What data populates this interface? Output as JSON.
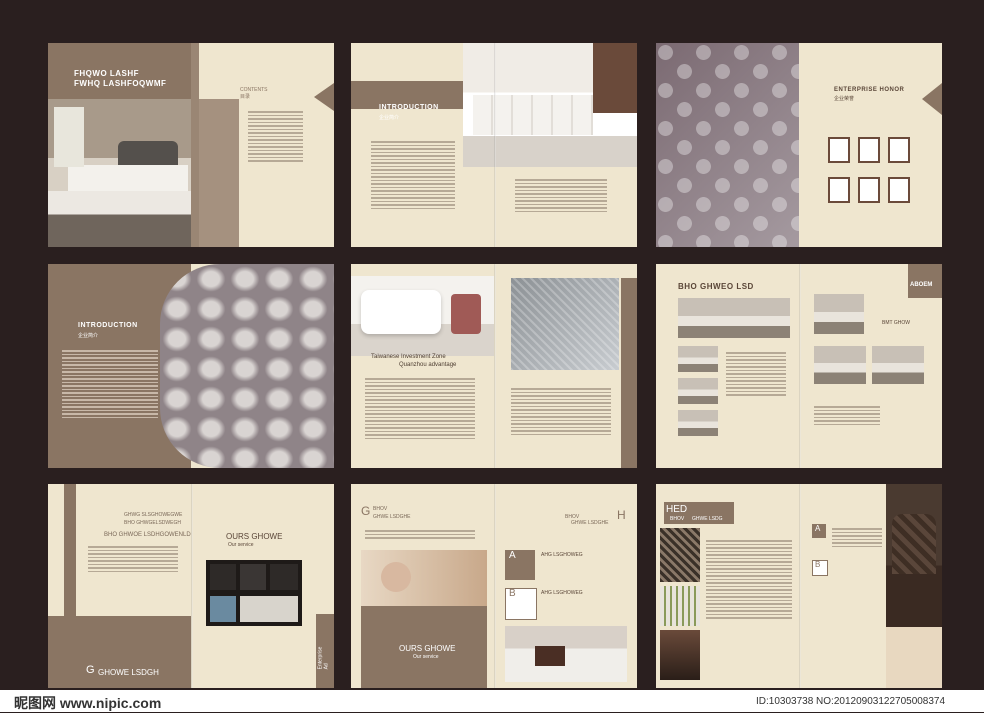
{
  "spreads": {
    "s1": {
      "title1": "FHQWO LASHF",
      "title2": "FWHQ LASHFOQWMF",
      "contents_en": "CONTENTS",
      "contents_cn": "目录"
    },
    "s2": {
      "title_en": "INTRODUCTION",
      "title_cn": "企业简介"
    },
    "s3": {
      "title_en": "ENTERPRISE HONOR",
      "title_cn": "企业荣誉"
    },
    "s4": {
      "title_en": "INTRODUCTION",
      "title_cn": "企业简介"
    },
    "s5": {
      "caption1": "Taiwanese Investment Zone",
      "caption2": "Quanzhou advantage"
    },
    "s6": {
      "title": "BHO GHWEO LSD",
      "tab": "ABOEM",
      "subtitle": "BMT GHOW"
    },
    "s7": {
      "heading1": "GHWG SLSGHOWEGWE",
      "heading2": "BHO GHWGELSDWEGH",
      "sub": "BHO GHWOE LSDHGOWENLD",
      "ours": "OURS GHOWE",
      "service": "Our service",
      "big_letter": "G",
      "big_rest": "GHOWE LSDGH",
      "side_label": "Enterprise Ad"
    },
    "s8": {
      "big_g": "G",
      "bhov": "BHOV",
      "ghwe": "GHWE LSDGHE",
      "ghwe2": "GHWE LSDGHE",
      "big_h": "H",
      "bhov2": "BHOV",
      "ours": "OURS GHOWE",
      "service": "Our service",
      "box_a": "A",
      "box_b": "B",
      "ahg1": "AHG LSGHOWEG",
      "ahg2": "AHG LSGHOWEG"
    },
    "s9": {
      "hed": "HED",
      "bhov": "BHOV",
      "ghwe": "GHWE LSDG",
      "box_a": "A",
      "box_b": "B"
    }
  },
  "footer": {
    "logo": "昵图网 www.nipic.com",
    "id_text": "ID:10303738 NO:20120903122705008374"
  }
}
